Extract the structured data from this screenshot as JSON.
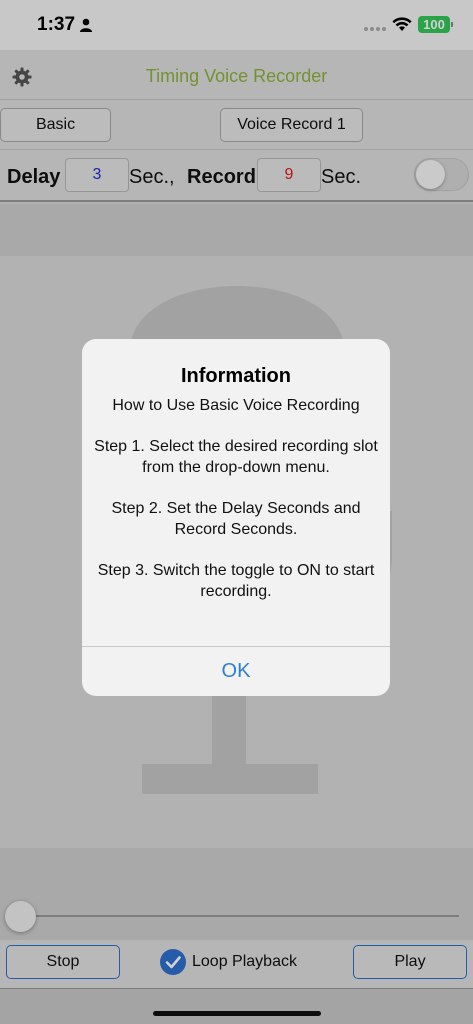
{
  "status_bar": {
    "time": "1:37",
    "battery": "100"
  },
  "nav": {
    "title": "Timing Voice Recorder"
  },
  "mode_row": {
    "mode_label": "Basic",
    "slot_label": "Voice Record 1"
  },
  "timer_row": {
    "delay_label": "Delay",
    "delay_value": "3",
    "delay_unit": "Sec.,",
    "record_label": "Record",
    "record_value": "9",
    "record_unit": "Sec.",
    "toggle_state": "off"
  },
  "playback": {
    "position": 0
  },
  "controls": {
    "stop_label": "Stop",
    "loop_label": "Loop Playback",
    "loop_checked": true,
    "play_label": "Play"
  },
  "dialog": {
    "title": "Information",
    "subtitle": "How to Use Basic Voice Recording",
    "step1": "Step 1. Select the desired recording slot from the drop-down menu.",
    "step2": "Step 2. Set the Delay Seconds and Record Seconds.",
    "step3": "Step 3. Switch the toggle to ON to start recording.",
    "ok_label": "OK"
  },
  "colors": {
    "title_green": "#8db33c",
    "delay_blue": "#1a2fd0",
    "record_red": "#e01b1b",
    "accent_blue": "#2f6fd0"
  }
}
